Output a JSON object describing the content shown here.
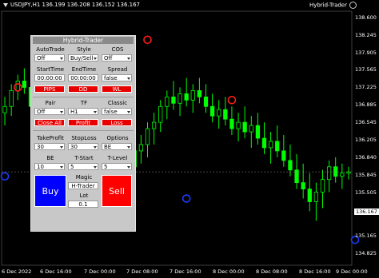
{
  "header": {
    "symbol_info": "USDJPY,H1  136.199 136.208 136.152 136.167",
    "indicator_name": "Hybrid-Trader"
  },
  "price_axis": {
    "labels": [
      "138.600",
      "138.245",
      "137.905",
      "137.565",
      "137.225",
      "136.885",
      "136.545",
      "136.205",
      "136.840",
      "135.845",
      "135.505",
      "135.165",
      "134.825"
    ],
    "current": "136.167"
  },
  "time_axis": {
    "labels": [
      "6 Dec 2022",
      "6 Dec 16:00",
      "7 Dec 00:00",
      "7 Dec 08:00",
      "7 Dec 16:00",
      "8 Dec 00:00",
      "8 Dec 08:00",
      "8 Dec 16:00",
      "9 Dec 00:00"
    ]
  },
  "panel": {
    "title": "Hybrid-Trader",
    "row1": {
      "labels": [
        "AutoTrade",
        "Style",
        "COS"
      ],
      "values": [
        "Off",
        "Buy/Sell",
        "Off"
      ]
    },
    "row2": {
      "labels": [
        "StartTime",
        "EndTime",
        "Spread"
      ],
      "values": [
        "00:00:00",
        "00:00:00",
        "false"
      ]
    },
    "row3_buttons": [
      "PIPS",
      "DD",
      "WL"
    ],
    "row4": {
      "labels": [
        "Pair",
        "TF",
        "Classic"
      ],
      "values": [
        "Off",
        "H1",
        "false"
      ]
    },
    "row5_buttons": [
      "Close All",
      "Profit",
      "Loss"
    ],
    "row6": {
      "labels": [
        "TakeProfit",
        "StopLoss",
        "Options"
      ],
      "values": [
        "30",
        "30",
        "BE"
      ]
    },
    "row7": {
      "labels": [
        "BE",
        "T-Start",
        "T-Level"
      ],
      "values": [
        "10",
        "5",
        "5"
      ]
    },
    "magic_label": "Magic",
    "magic_value": "H-Trader",
    "lot_label": "Lot",
    "lot_value": "0.1",
    "buy_label": "Buy",
    "sell_label": "Sell"
  },
  "colors": {
    "bull": "#00ff00",
    "bear": "#00ff00",
    "buy_button": "#0000ff",
    "sell_button": "#ff0000",
    "accent_red": "#e80000"
  },
  "chart_data": {
    "type": "candlestick",
    "symbol": "USDJPY",
    "timeframe": "H1",
    "ohlc": [
      [
        137.1,
        137.35,
        136.9,
        137.2
      ],
      [
        137.2,
        137.55,
        137.05,
        137.45
      ],
      [
        137.45,
        137.7,
        137.3,
        137.6
      ],
      [
        137.6,
        137.8,
        137.4,
        137.5
      ],
      [
        137.5,
        137.6,
        137.1,
        137.2
      ],
      [
        137.2,
        137.4,
        136.95,
        137.1
      ],
      [
        137.1,
        137.3,
        136.8,
        136.95
      ],
      [
        136.95,
        137.15,
        136.7,
        137.05
      ],
      [
        137.05,
        137.25,
        136.85,
        136.9
      ],
      [
        136.9,
        137.1,
        136.6,
        136.7
      ],
      [
        136.7,
        136.95,
        136.45,
        136.85
      ],
      [
        136.85,
        137.0,
        136.5,
        136.55
      ],
      [
        136.55,
        136.8,
        136.3,
        136.65
      ],
      [
        136.65,
        136.9,
        136.4,
        136.5
      ],
      [
        136.5,
        136.7,
        136.15,
        136.3
      ],
      [
        136.3,
        136.6,
        136.1,
        136.45
      ],
      [
        136.45,
        136.7,
        136.2,
        136.35
      ],
      [
        136.35,
        136.55,
        136.0,
        136.2
      ],
      [
        136.2,
        136.5,
        135.95,
        136.4
      ],
      [
        136.4,
        136.65,
        136.15,
        136.25
      ],
      [
        136.25,
        136.6,
        136.1,
        136.5
      ],
      [
        136.5,
        136.75,
        136.3,
        136.6
      ],
      [
        136.6,
        136.95,
        136.4,
        136.85
      ],
      [
        136.85,
        137.1,
        136.6,
        136.95
      ],
      [
        136.95,
        137.3,
        136.8,
        137.2
      ],
      [
        137.2,
        137.45,
        137.0,
        137.35
      ],
      [
        137.35,
        137.6,
        137.15,
        137.25
      ],
      [
        137.25,
        137.5,
        137.05,
        137.4
      ],
      [
        137.4,
        137.65,
        137.2,
        137.3
      ],
      [
        137.3,
        137.55,
        137.1,
        137.45
      ],
      [
        137.45,
        137.65,
        137.25,
        137.35
      ],
      [
        137.35,
        137.55,
        137.1,
        137.2
      ],
      [
        137.2,
        137.4,
        136.95,
        137.05
      ],
      [
        137.05,
        137.3,
        136.85,
        137.15
      ],
      [
        137.15,
        137.35,
        136.9,
        137.0
      ],
      [
        137.0,
        137.2,
        136.75,
        136.85
      ],
      [
        136.85,
        137.1,
        136.65,
        136.95
      ],
      [
        136.95,
        137.2,
        136.7,
        136.8
      ],
      [
        136.8,
        137.05,
        136.55,
        136.9
      ],
      [
        136.9,
        137.1,
        136.6,
        136.7
      ],
      [
        136.7,
        136.95,
        136.45,
        136.55
      ],
      [
        136.55,
        136.8,
        136.3,
        136.65
      ],
      [
        136.65,
        136.9,
        136.4,
        136.5
      ],
      [
        136.5,
        136.75,
        136.25,
        136.35
      ],
      [
        136.35,
        136.6,
        136.1,
        136.2
      ],
      [
        136.2,
        136.45,
        135.9,
        136.0
      ],
      [
        136.0,
        136.3,
        135.75,
        135.9
      ],
      [
        135.9,
        136.15,
        135.55,
        135.7
      ],
      [
        135.7,
        136.0,
        135.4,
        135.85
      ],
      [
        135.85,
        136.2,
        135.6,
        136.05
      ],
      [
        136.05,
        136.35,
        135.85,
        136.25
      ],
      [
        136.25,
        136.4,
        136.0,
        136.1
      ],
      [
        136.1,
        136.3,
        135.9,
        136.15
      ],
      [
        136.15,
        136.25,
        136.05,
        136.17
      ]
    ],
    "ylim": [
      134.7,
      138.7
    ],
    "markers": [
      {
        "kind": "sell",
        "index": 2,
        "price": 137.5
      },
      {
        "kind": "buy",
        "index": 0,
        "price": 136.1
      },
      {
        "kind": "sell",
        "index": 22,
        "price": 138.25
      },
      {
        "kind": "sell",
        "index": 35,
        "price": 137.3
      },
      {
        "kind": "buy",
        "index": 28,
        "price": 135.75
      },
      {
        "kind": "buy",
        "index": 54,
        "price": 135.1
      }
    ]
  }
}
